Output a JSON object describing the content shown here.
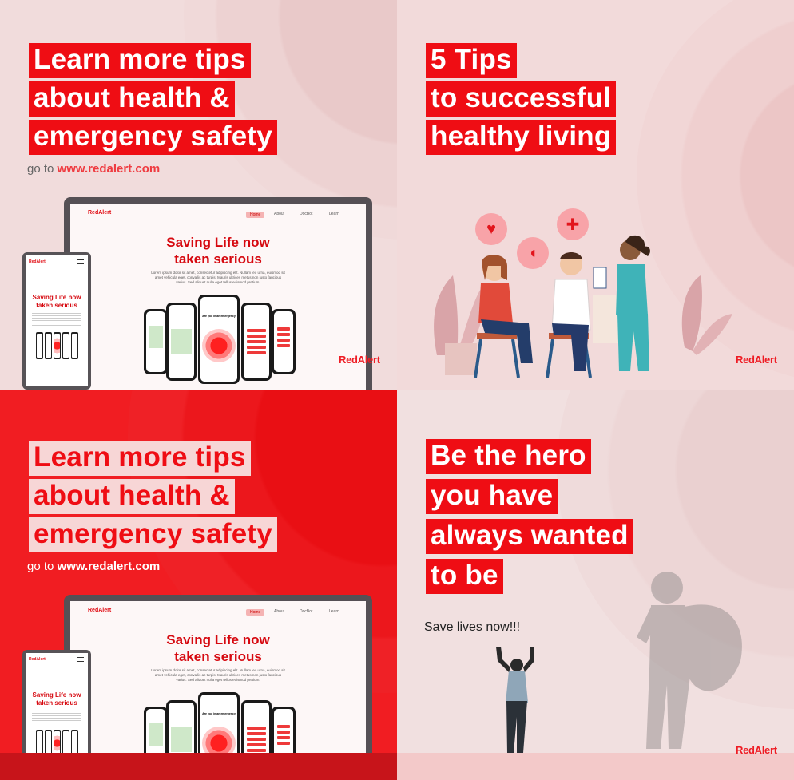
{
  "panels": {
    "p1": {
      "headline": [
        "Learn more tips",
        "about health &",
        "emergency safety"
      ],
      "goto_prefix": "go to",
      "goto_url": "www.redalert.com"
    },
    "p2": {
      "headline": [
        "5 Tips",
        "to successful",
        "healthy living"
      ]
    },
    "p3": {
      "headline": [
        "Learn more tips",
        "about health &",
        "emergency safety"
      ],
      "goto_prefix": "go to",
      "goto_url": "www.redalert.com"
    },
    "p4": {
      "headline": [
        "Be the hero",
        "you have",
        "always wanted",
        "to be"
      ],
      "subtext": "Save lives now!!!"
    }
  },
  "mockup": {
    "logo": "RedAlert",
    "nav": [
      "Home",
      "About",
      "DocBot",
      "Learn"
    ],
    "title_line1": "Saving Life now",
    "title_line2": "taken serious",
    "body": "Lorem ipsum dolor sit amet, consectetur adipiscing elit. Nullam leo urna, euismod sit amet vehicula eget, convallis ac turpis. Mauris ultrices metus non justo faucibus varius. Sed aliquet nulla eget tellus euismod pretium.",
    "phone_prompt": "Are you in an emergency",
    "mobile_title_line1": "Saving Life now",
    "mobile_title_line2": "taken serious"
  },
  "brand": "RedAlert",
  "colors": {
    "brand_red": "#ef0d14",
    "panel_pink": "#f1dcdc",
    "panel_red": "#f11d22"
  },
  "icons": [
    "heart-monitor-icon",
    "medical-cross-icon",
    "pill-icon"
  ]
}
